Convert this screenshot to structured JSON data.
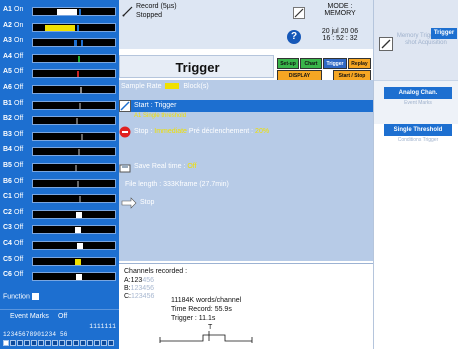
{
  "channels": [
    {
      "name": "A1",
      "state": "On"
    },
    {
      "name": "A2",
      "state": "On"
    },
    {
      "name": "A3",
      "state": "On"
    },
    {
      "name": "A4",
      "state": "Off"
    },
    {
      "name": "A5",
      "state": "Off"
    },
    {
      "name": "A6",
      "state": "Off"
    },
    {
      "name": "B1",
      "state": "Off"
    },
    {
      "name": "B2",
      "state": "Off"
    },
    {
      "name": "B3",
      "state": "Off"
    },
    {
      "name": "B4",
      "state": "Off"
    },
    {
      "name": "B5",
      "state": "Off"
    },
    {
      "name": "B6",
      "state": "Off"
    },
    {
      "name": "C1",
      "state": "Off"
    },
    {
      "name": "C2",
      "state": "Off"
    },
    {
      "name": "C3",
      "state": "Off"
    },
    {
      "name": "C4",
      "state": "Off"
    },
    {
      "name": "C5",
      "state": "Off"
    },
    {
      "name": "C6",
      "state": "Off"
    }
  ],
  "function_label": "Function",
  "event_marks": {
    "label": "Event Marks",
    "value": "Off",
    "digits_row1": "1111111",
    "digits_row2": "12345678901234 56"
  },
  "record": {
    "label": "Record (5µs)",
    "state": "Stopped"
  },
  "mode": {
    "line1": "MODE :",
    "line2": "MEMORY"
  },
  "date": {
    "date": "20 jul 20 06",
    "time": "16 : 52 : 32"
  },
  "page_title": "Trigger",
  "toolbar": {
    "setup": "Set-up",
    "chart": "Chart",
    "trigger": "Trigger",
    "replay": "Replay",
    "display": "DISPLAY",
    "start_stop": "Start / Stop"
  },
  "content": {
    "sample_rate": "Sample Rate",
    "blocks": "Block(s)",
    "start_label": "Start : Trigger",
    "start_sub": "A1 Single threshold",
    "stop_label": "Stop :",
    "stop_value": "Immediate",
    "pre_trigger": "Pré déclenchement :",
    "pre_trigger_value": "20%",
    "save_label": "Save Real time :",
    "save_value": "Off",
    "file_label": "File length :",
    "file_value": "333Kframe (27.7min)",
    "loop_label": "Stop"
  },
  "channels_recorded": {
    "title": "Channels recorded :",
    "a_label": "A:",
    "a_value": "123",
    "a_dim": "456",
    "b_label": "B:",
    "b_dim": "123456",
    "c_label": "C:",
    "c_dim": "123456"
  },
  "info": {
    "words": "11184K words/channel",
    "time_record": "Time Record: 55.9s",
    "trigger": "Trigger : 11.1s",
    "t_marker": "T"
  },
  "sidebar": {
    "trigger_btn": "Trigger",
    "top_faded": "Memory Trigger Multi-shot Acquisition",
    "analog_btn": "Analog Chan.",
    "analog_sub": "Event Marks",
    "threshold_btn": "Single Threshold",
    "threshold_sub": "Conditions Trigger"
  },
  "colors": {
    "panel_blue": "#1d6fd0",
    "content_bg": "#b7cbe7",
    "highlight_yellow": "#f0e000",
    "stop_red": "#e02020",
    "green_btn": "#39b54a",
    "orange_btn": "#f5a623"
  }
}
